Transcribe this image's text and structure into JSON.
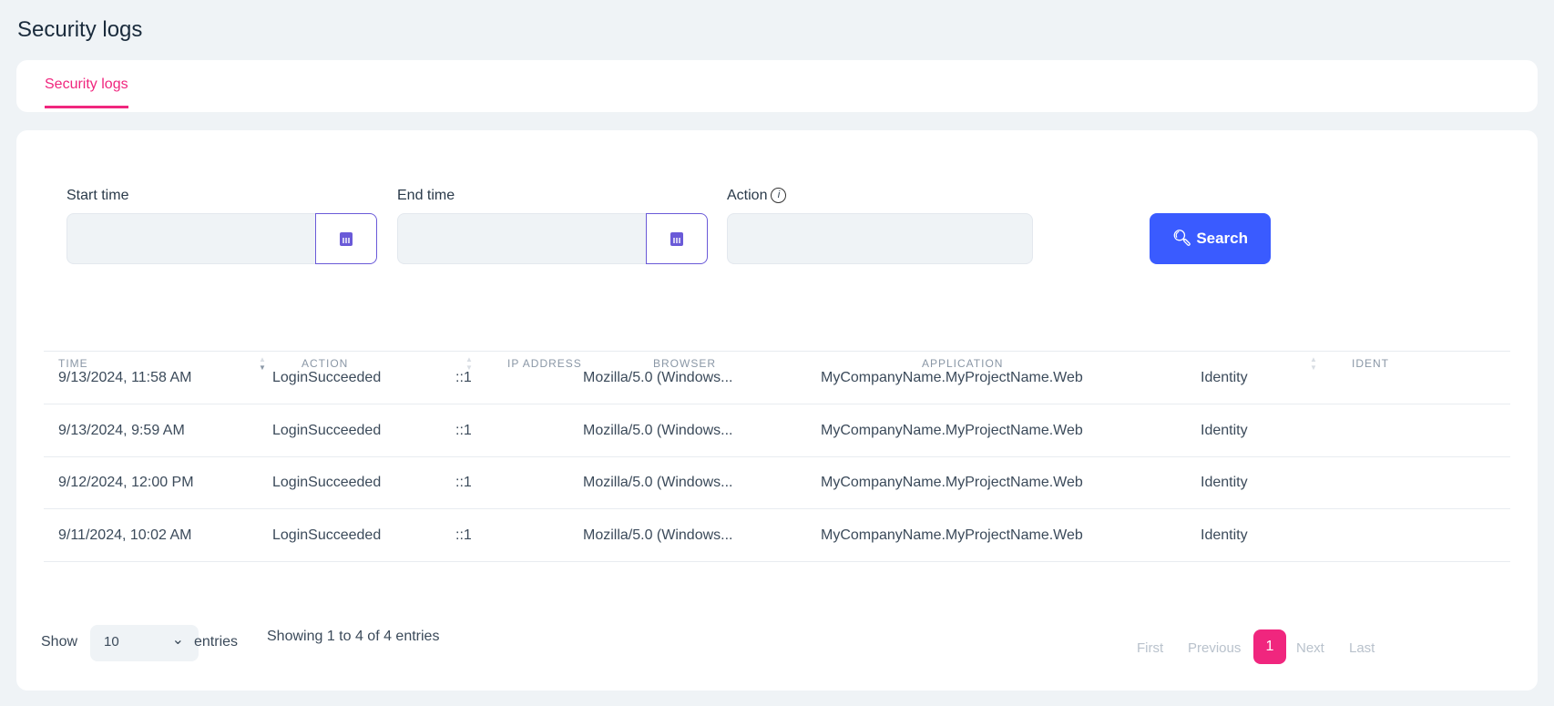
{
  "page_title": "Security logs",
  "tab": "Security logs",
  "filters": {
    "start_label": "Start time",
    "end_label": "End time",
    "action_label": "Action",
    "start_value": "",
    "end_value": "",
    "action_value": "",
    "search_label": "Search"
  },
  "columns": [
    "TIME",
    "ACTION",
    "IP ADDRESS",
    "BROWSER",
    "APPLICATION",
    "IDENT"
  ],
  "rows": [
    {
      "time": "9/13/2024, 11:58 AM",
      "action": "LoginSucceeded",
      "ip": "::1",
      "browser": "Mozilla/5.0 (Windows...",
      "application": "MyCompanyName.MyProjectName.Web",
      "identity": "Identity"
    },
    {
      "time": "9/13/2024, 9:59 AM",
      "action": "LoginSucceeded",
      "ip": "::1",
      "browser": "Mozilla/5.0 (Windows...",
      "application": "MyCompanyName.MyProjectName.Web",
      "identity": "Identity"
    },
    {
      "time": "9/12/2024, 12:00 PM",
      "action": "LoginSucceeded",
      "ip": "::1",
      "browser": "Mozilla/5.0 (Windows...",
      "application": "MyCompanyName.MyProjectName.Web",
      "identity": "Identity"
    },
    {
      "time": "9/11/2024, 10:02 AM",
      "action": "LoginSucceeded",
      "ip": "::1",
      "browser": "Mozilla/5.0 (Windows...",
      "application": "MyCompanyName.MyProjectName.Web",
      "identity": "Identity"
    }
  ],
  "footer": {
    "show": "Show",
    "page_size": "10",
    "entries": "entries",
    "summary": "Showing 1 to 4 of 4 entries"
  },
  "pagination": {
    "first": "First",
    "previous": "Previous",
    "current": "1",
    "next": "Next",
    "last": "Last"
  }
}
